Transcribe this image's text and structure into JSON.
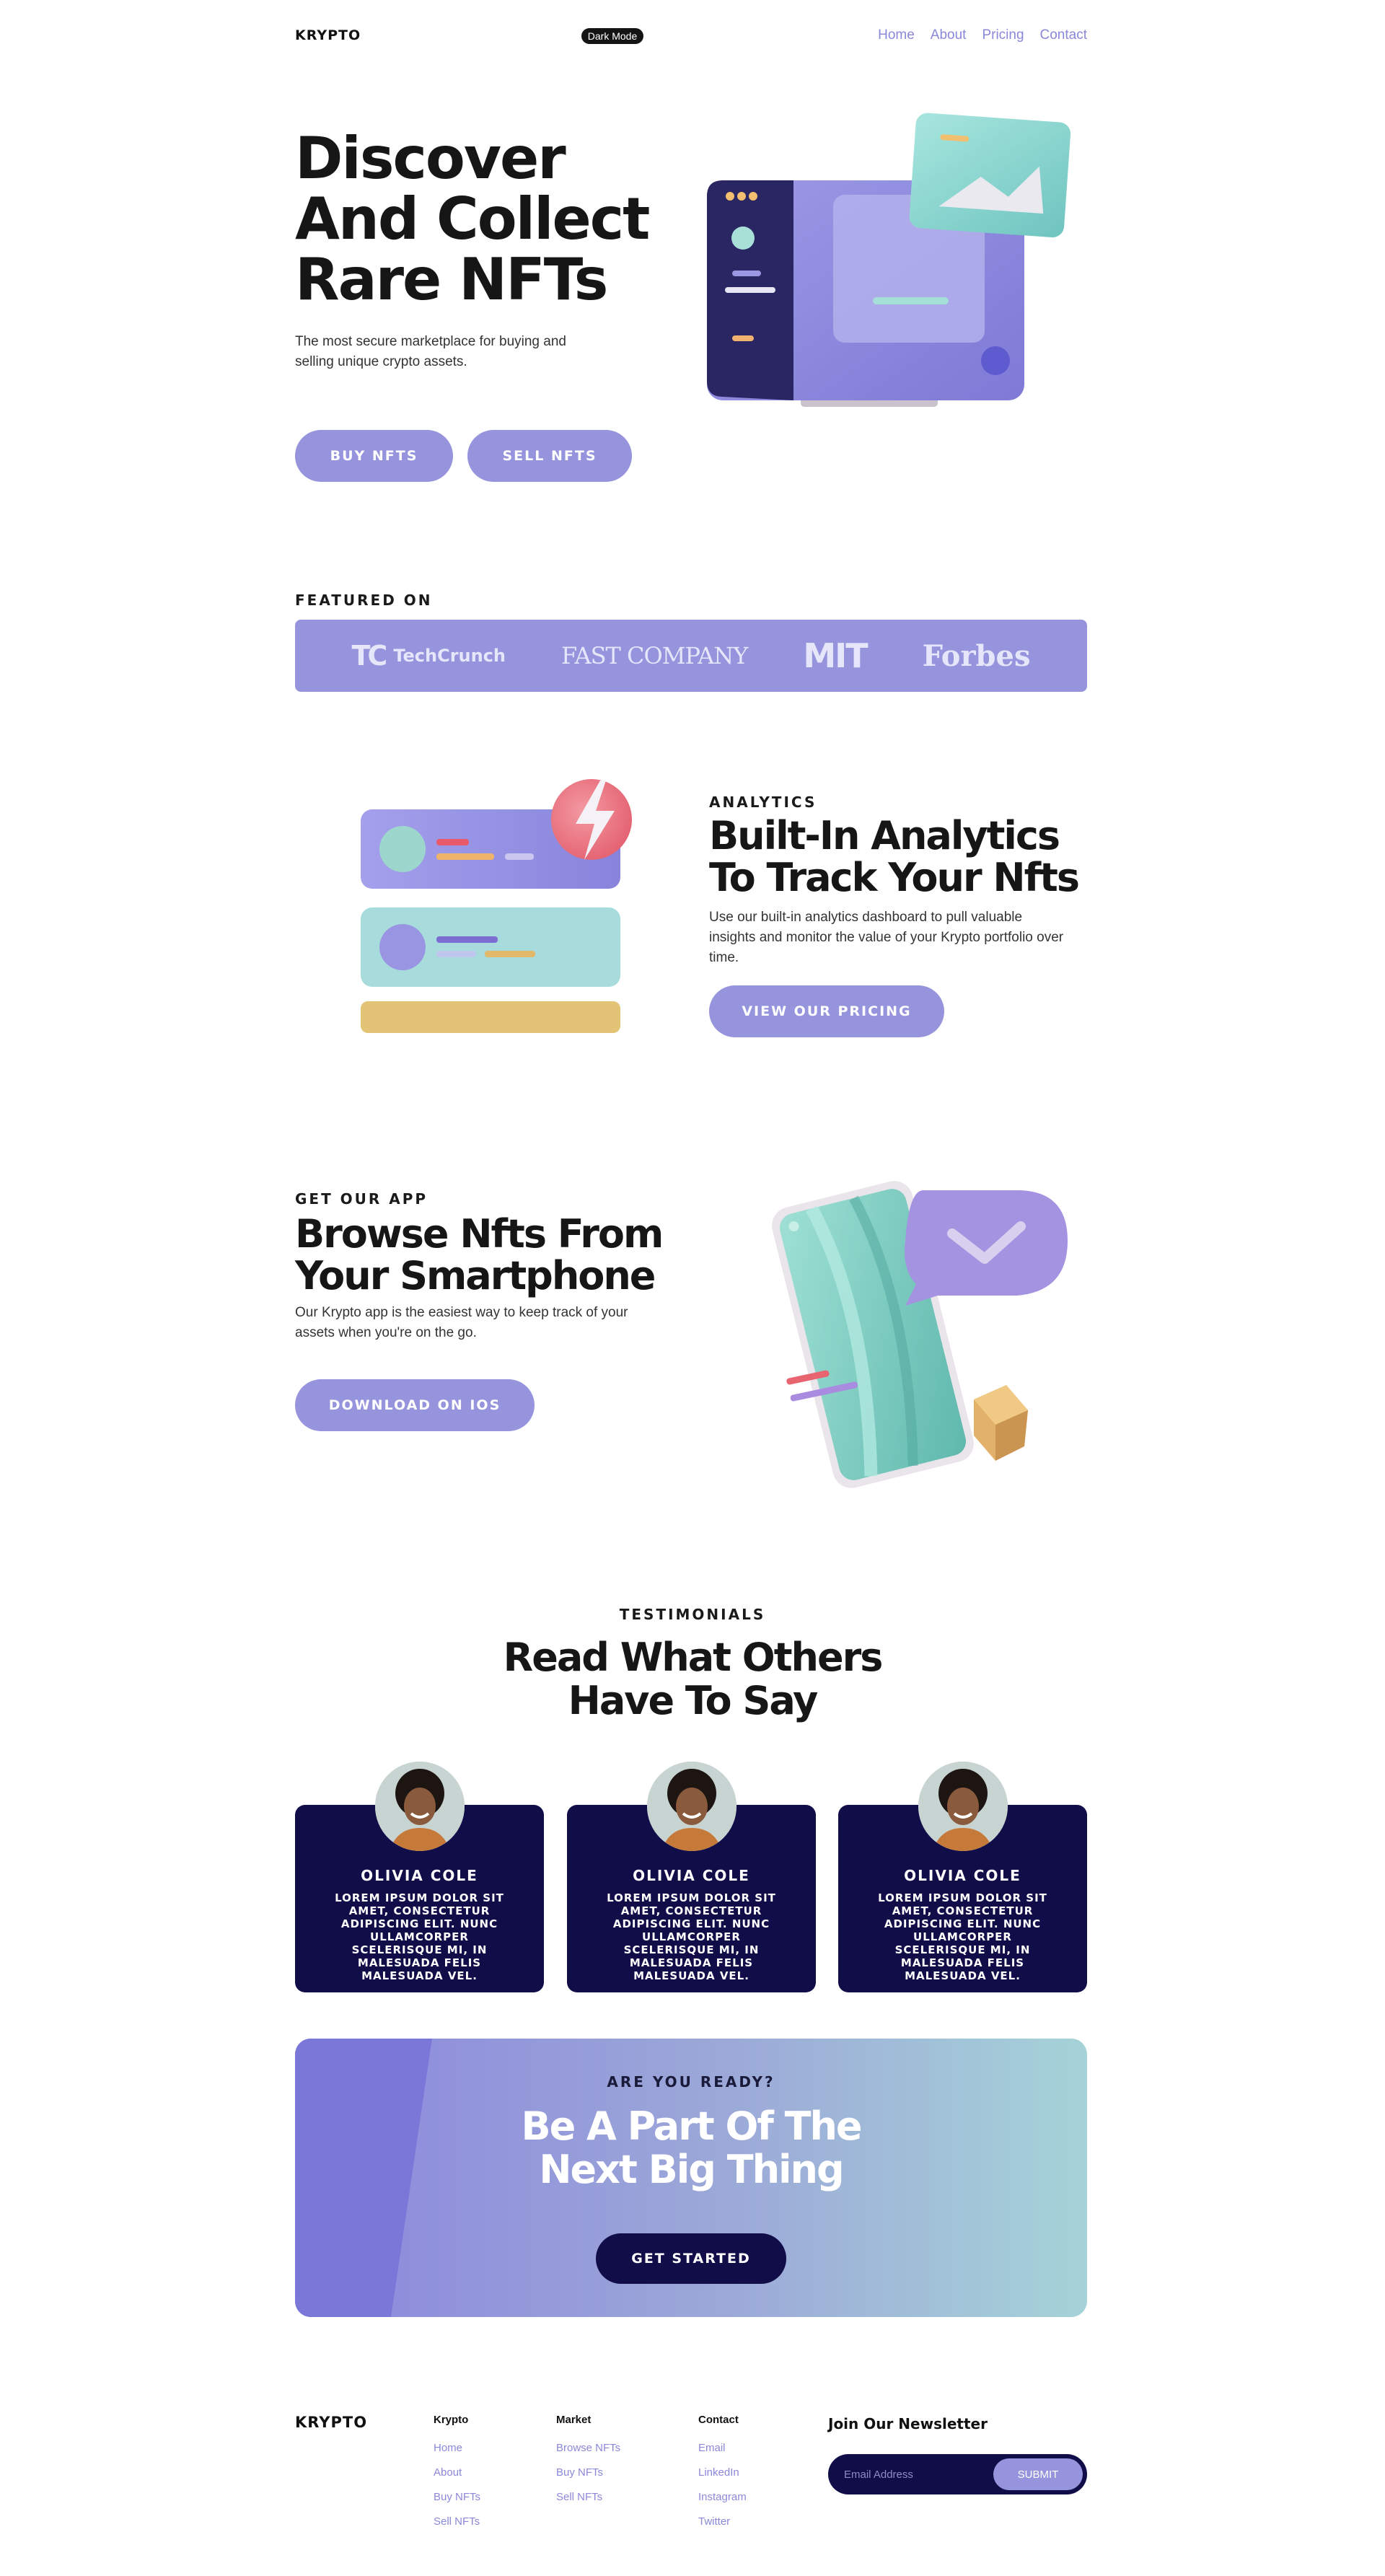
{
  "colors": {
    "accent": "#9694dd",
    "navy": "#110d49",
    "link": "#8a88d8"
  },
  "nav": {
    "logo": "KRYPTO",
    "dark_mode_label": "Dark Mode",
    "links": [
      "Home",
      "About",
      "Pricing",
      "Contact"
    ]
  },
  "hero": {
    "title_lines": [
      "Discover",
      "And Collect",
      "Rare NFTs"
    ],
    "subtitle": "The most secure marketplace for buying and selling unique crypto assets.",
    "buy_label": "BUY NFTS",
    "sell_label": "SELL NFTS"
  },
  "featured": {
    "label": "FEATURED ON",
    "logos": [
      "TechCrunch",
      "FAST COMPANY",
      "MIT",
      "Forbes"
    ]
  },
  "analytics": {
    "label": "ANALYTICS",
    "title_lines": [
      "Built-In Analytics",
      "To Track Your Nfts"
    ],
    "text": "Use our built-in analytics dashboard to pull valuable insights and monitor the value of your Krypto portfolio over time.",
    "button_label": "VIEW OUR PRICING"
  },
  "app": {
    "label": "GET OUR APP",
    "title_lines": [
      "Browse Nfts From",
      "Your Smartphone"
    ],
    "text": "Our Krypto app is the easiest way to keep track of your assets when you're on the go.",
    "button_label": "DOWNLOAD ON IOS"
  },
  "testimonials": {
    "label": "TESTIMONIALS",
    "title_lines": [
      "Read What Others",
      "Have To Say"
    ],
    "cards": [
      {
        "name": "OLIVIA COLE",
        "quote": "Lorem ipsum dolor sit amet, consectetur adipiscing elit. Nunc ullamcorper scelerisque mi, in malesuada felis malesuada vel."
      },
      {
        "name": "OLIVIA COLE",
        "quote": "Lorem ipsum dolor sit amet, consectetur adipiscing elit. Nunc ullamcorper scelerisque mi, in malesuada felis malesuada vel."
      },
      {
        "name": "OLIVIA COLE",
        "quote": "Lorem ipsum dolor sit amet, consectetur adipiscing elit. Nunc ullamcorper scelerisque mi, in malesuada felis malesuada vel."
      }
    ]
  },
  "cta": {
    "label": "ARE YOU READY?",
    "title_lines": [
      "Be A Part Of The",
      "Next Big Thing"
    ],
    "button_label": "GET STARTED"
  },
  "footer": {
    "logo": "KRYPTO",
    "columns": [
      {
        "title": "Krypto",
        "links": [
          "Home",
          "About",
          "Buy NFTs",
          "Sell NFTs"
        ]
      },
      {
        "title": "Market",
        "links": [
          "Browse NFTs",
          "Buy NFTs",
          "Sell NFTs"
        ]
      },
      {
        "title": "Contact",
        "links": [
          "Email",
          "LinkedIn",
          "Instagram",
          "Twitter"
        ]
      }
    ],
    "newsletter": {
      "title": "Join Our Newsletter",
      "placeholder": "Email Address",
      "button_label": "SUBMIT"
    }
  }
}
